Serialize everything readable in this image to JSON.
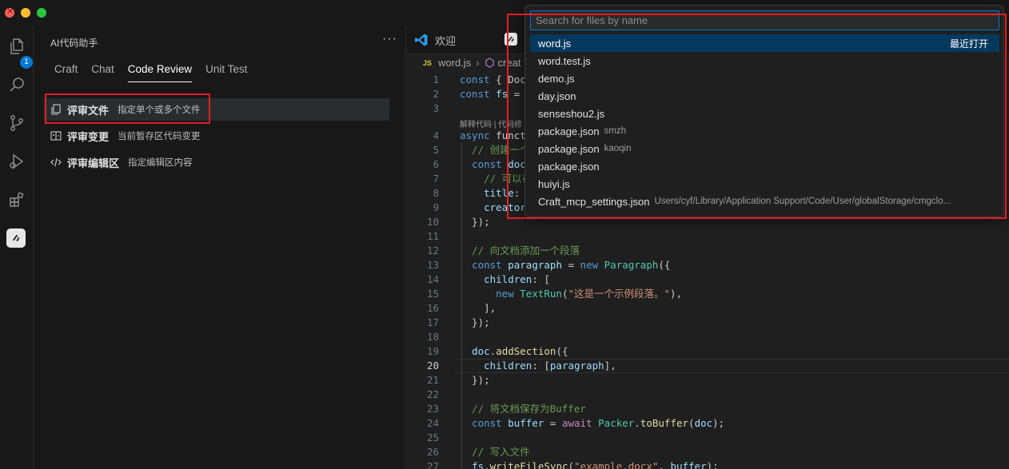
{
  "sidebar": {
    "title": "AI代码助手",
    "more": "···",
    "tabs": [
      {
        "label": "Craft"
      },
      {
        "label": "Chat"
      },
      {
        "label": "Code Review"
      },
      {
        "label": "Unit Test"
      }
    ],
    "review_items": [
      {
        "label": "评审文件",
        "desc": "指定单个或多个文件"
      },
      {
        "label": "评审变更",
        "desc": "当前暂存区代码变更"
      },
      {
        "label": "评审编辑区",
        "desc": "指定编辑区内容"
      }
    ]
  },
  "activity": {
    "badge": "1"
  },
  "editor": {
    "tab_label": "欢迎",
    "breadcrumb_file": "word.js",
    "breadcrumb_js": "JS",
    "breadcrumb_symbol": "creat",
    "codelens": "解释代码 | 代码修",
    "current_line": 20
  },
  "quickpick": {
    "placeholder": "Search for files by name",
    "recent_label": "最近打开",
    "items": [
      {
        "name": "word.js",
        "desc": ""
      },
      {
        "name": "word.test.js",
        "desc": ""
      },
      {
        "name": "demo.js",
        "desc": ""
      },
      {
        "name": "day.json",
        "desc": ""
      },
      {
        "name": "senseshou2.js",
        "desc": ""
      },
      {
        "name": "package.json",
        "desc": "smzh"
      },
      {
        "name": "package.json",
        "desc": "kaoqin"
      },
      {
        "name": "package.json",
        "desc": ""
      },
      {
        "name": "huiyi.js",
        "desc": ""
      },
      {
        "name": "Craft_mcp_settings.json",
        "desc": "Users/cyf/Library/Application Support/Code/User/globalStorage/cmgclo..."
      }
    ]
  },
  "code_lines": [
    {
      "n": "1",
      "t": "const { Doc"
    },
    {
      "n": "2",
      "t": "const fs ="
    },
    {
      "n": "3",
      "t": ""
    },
    {
      "n": "4",
      "t": "async funct"
    },
    {
      "n": "5",
      "t": "  // 创建一个"
    },
    {
      "n": "6",
      "t": "  const doc"
    },
    {
      "n": "7",
      "t": "    // 可以在"
    },
    {
      "n": "8",
      "t": "    title:"
    },
    {
      "n": "9",
      "t": "    creator"
    },
    {
      "n": "10",
      "t": "  });"
    },
    {
      "n": "11",
      "t": ""
    },
    {
      "n": "12",
      "t": "  // 向文档添加一个段落"
    },
    {
      "n": "13",
      "t": "  const paragraph = new Paragraph({"
    },
    {
      "n": "14",
      "t": "    children: ["
    },
    {
      "n": "15",
      "t": "      new TextRun(\"这是一个示例段落。\"),"
    },
    {
      "n": "16",
      "t": "    ],"
    },
    {
      "n": "17",
      "t": "  });"
    },
    {
      "n": "18",
      "t": ""
    },
    {
      "n": "19",
      "t": "  doc.addSection({"
    },
    {
      "n": "20",
      "t": "    children: [paragraph],"
    },
    {
      "n": "21",
      "t": "  });"
    },
    {
      "n": "22",
      "t": ""
    },
    {
      "n": "23",
      "t": "  // 将文档保存为Buffer"
    },
    {
      "n": "24",
      "t": "  const buffer = await Packer.toBuffer(doc);"
    },
    {
      "n": "25",
      "t": ""
    },
    {
      "n": "26",
      "t": "  // 写入文件"
    },
    {
      "n": "27",
      "t": "  fs.writeFileSync(\"example.docx\", buffer);"
    }
  ]
}
